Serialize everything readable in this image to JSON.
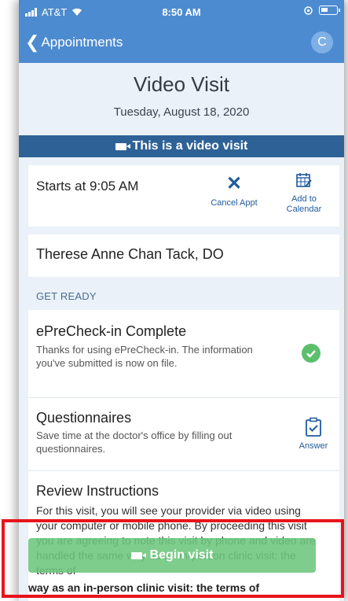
{
  "status_bar": {
    "carrier": "AT&T",
    "time": "8:50 AM"
  },
  "nav": {
    "back_label": "Appointments",
    "avatar_initial": "C"
  },
  "header": {
    "title": "Video Visit",
    "date": "Tuesday, August 18, 2020"
  },
  "video_banner": "This is a video visit",
  "appointment": {
    "starts": "Starts at 9:05 AM",
    "cancel_label": "Cancel Appt",
    "add_calendar_label": "Add to Calendar"
  },
  "provider": "Therese Anne Chan Tack, DO",
  "section_title": "GET READY",
  "tasks": [
    {
      "title": "ePreCheck-in Complete",
      "description": "Thanks for using ePreCheck-in. The information you've submitted is now on file."
    },
    {
      "title": "Questionnaires",
      "description": "Save time at the doctor's office by filling out questionnaires.",
      "action": "Answer"
    },
    {
      "title": "Review Instructions",
      "description": "For this visit, you will see your provider via video using your computer or mobile phone. By proceeding this visit you are agreeing to note this visit by phone and video are handled the same way as an in-person clinic visit: the terms of"
    }
  ],
  "begin_button": "Begin visit",
  "overflow_text": "way as an in-person clinic visit: the terms of",
  "colors": {
    "nav_blue": "#4d8bd0",
    "banner_blue": "#2e6296",
    "link_blue": "#1e5a9c",
    "success_green": "#5cbf6e",
    "highlight_red": "#e8141b"
  }
}
